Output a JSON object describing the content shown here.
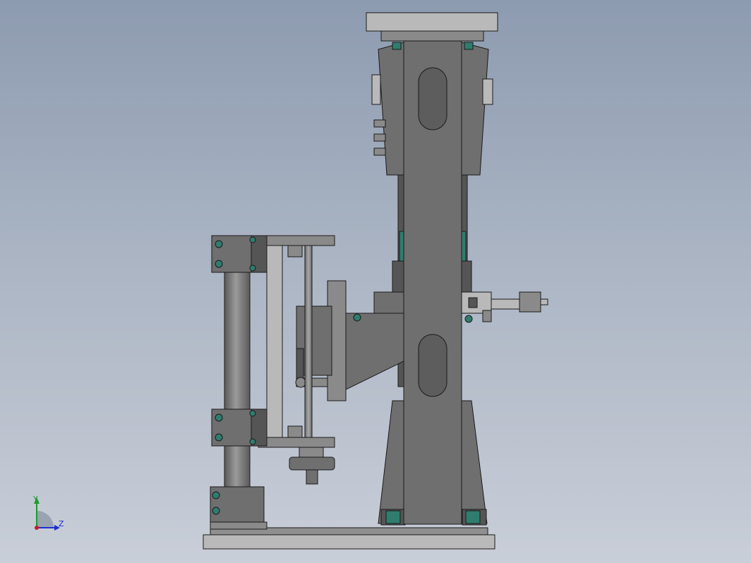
{
  "triad": {
    "y_label": "Y",
    "z_label": "Z",
    "colors": {
      "y": "#1c9c2c",
      "z": "#1d2fd0",
      "origin": "#c0202a"
    }
  },
  "model": {
    "colors": {
      "background_top": "#8d9bb0",
      "background_bottom": "#c9ced8",
      "body": "#6f6f6f",
      "body_dark": "#555555",
      "body_light": "#8a8a8a",
      "plate": "#b9b9b9",
      "rod": "#7a7a7a",
      "bolt": "#2f7d6e",
      "outline": "#1a1a1a"
    }
  }
}
